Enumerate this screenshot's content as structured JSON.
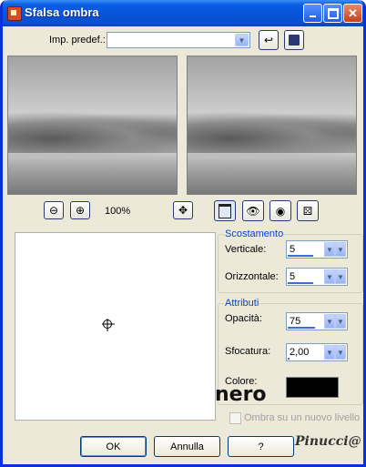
{
  "window": {
    "title": "Sfalsa ombra"
  },
  "preset": {
    "label": "Imp. predef.:",
    "value": ""
  },
  "zoom": {
    "level": "100%"
  },
  "scostamento": {
    "title": "Scostamento",
    "verticale": {
      "label": "Verticale:",
      "value": "5",
      "fill": 0.7
    },
    "orizzontale": {
      "label": "Orizzontale:",
      "value": "5",
      "fill": 0.7
    }
  },
  "attributi": {
    "title": "Attributi",
    "opacita": {
      "label": "Opacità:",
      "value": "75",
      "fill": 0.75
    },
    "sfocatura": {
      "label": "Sfocatura:",
      "value": "2,00",
      "fill": 0.05
    },
    "colore": {
      "label": "Colore:",
      "value": "#000000"
    }
  },
  "overlay_text": "nero",
  "new_layer": {
    "label": "Ombra su un nuovo livello",
    "checked": false
  },
  "buttons": {
    "ok": "OK",
    "cancel": "Annulla",
    "help": "?"
  },
  "watermark": "Pinucci@"
}
